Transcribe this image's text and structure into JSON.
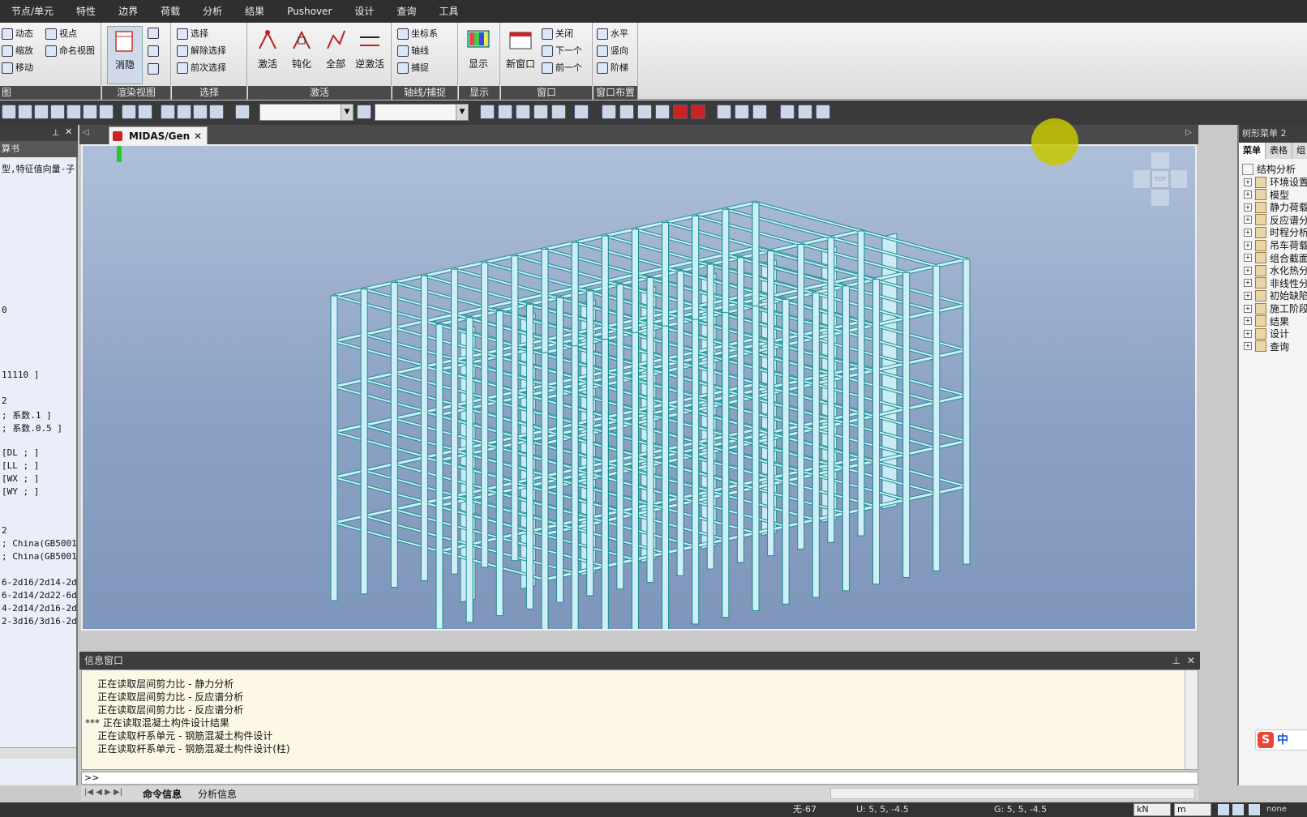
{
  "menu": [
    "节点/单元",
    "特性",
    "边界",
    "荷载",
    "分析",
    "结果",
    "Pushover",
    "设计",
    "查询",
    "工具"
  ],
  "ribbon": {
    "view_group": {
      "caption": "图",
      "items": [
        "动态",
        "视点",
        "缩放",
        "命名视图",
        "移动"
      ]
    },
    "render_group": {
      "caption": "渲染视图",
      "large": "消隐"
    },
    "select_group": {
      "caption": "选择",
      "items": [
        "选择",
        "解除选择",
        "前次选择"
      ]
    },
    "activate_group": {
      "caption": "激活",
      "buttons": [
        "激活",
        "钝化",
        "全部",
        "逆激活"
      ]
    },
    "axis_group": {
      "caption": "轴线/捕捉",
      "items": [
        "坐标系",
        "轴线",
        "捕捉"
      ]
    },
    "display_group": {
      "caption": "显示",
      "large": "显示"
    },
    "window_group": {
      "caption": "窗口",
      "large": "新窗口",
      "items": [
        "关闭",
        "下一个",
        "前一个"
      ]
    },
    "layout_group": {
      "caption": "窗口布置",
      "items": [
        "水平",
        "竖向",
        "阶梯"
      ]
    }
  },
  "left_panel": {
    "sub_title": "算书",
    "lines": [
      "型,特征值向量-子",
      "",
      "",
      "",
      "",
      "",
      "",
      "",
      "",
      "",
      "",
      "0",
      "",
      "",
      "",
      "",
      "11110 ]",
      "",
      "2",
      "; 系数.1 ]",
      "; 系数.0.5 ]",
      "",
      "[DL ; ]",
      "[LL ; ]",
      "[WX ; ]",
      "[WY ; ]",
      "",
      "",
      "2",
      "; China(GB50011",
      "; China(GB50011",
      "",
      "6-2d16/2d14-2d14",
      "6-2d14/2d22-6d14",
      "4-2d14/2d16-2d14",
      "2-3d16/3d16-2d22"
    ]
  },
  "document_tab": "MIDAS/Gen",
  "info_window": {
    "title": "信息窗口",
    "lines": [
      "    正在读取层间剪力比 - 静力分析",
      "    正在读取层间剪力比 - 反应谱分析",
      "    正在读取层间剪力比 - 反应谱分析",
      "*** 正在读取混凝土构件设计结果",
      "    正在读取杆系单元 - 钢筋混凝土构件设计",
      "    正在读取杆系单元 - 钢筋混凝土构件设计(柱)"
    ],
    "prompt": ">>",
    "tabs": [
      "命令信息",
      "分析信息"
    ]
  },
  "right_panel": {
    "title": "树形菜单 2",
    "tabs": [
      "菜单",
      "表格",
      "组"
    ],
    "root": "结构分析",
    "items": [
      "环境设置",
      "模型",
      "静力荷载",
      "反应谱分",
      "时程分析",
      "吊车荷载",
      "组合截面",
      "水化热分",
      "非线性分",
      "初始缺陷",
      "施工阶段",
      "结果",
      "设计",
      "查询"
    ]
  },
  "ime_badge": "中",
  "status_bar": {
    "node": "无-67",
    "ucs": "U: 5, 5, -4.5",
    "gcs": "G: 5, 5, -4.5",
    "force_unit": "kN",
    "length_unit": "m",
    "extra": "none"
  },
  "colors": {
    "view_top": "#aebfd8",
    "view_bottom": "#7f96bc",
    "frame": "#cfeff8",
    "frame_edge": "#1a8c8c",
    "highlight": "#c8c800"
  }
}
